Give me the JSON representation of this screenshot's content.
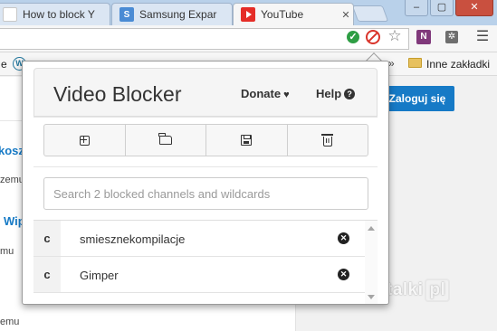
{
  "tabs": [
    {
      "title": "How to block Y",
      "favicon": "google-favicon"
    },
    {
      "title": "Samsung Expar",
      "favicon": "s-favicon",
      "favicon_letter": "S"
    },
    {
      "title": "YouTube",
      "favicon": "youtube-favicon"
    }
  ],
  "toolbar": {
    "icons": [
      "check-icon",
      "block-icon",
      "star-icon",
      "onenote-icon",
      "extension-icon",
      "menu-icon"
    ],
    "onenote_letter": "N"
  },
  "bookmarks": {
    "left_fragment": "e",
    "folder_label": "Inne zakładki"
  },
  "page": {
    "fragments": [
      "koszt",
      "zemu",
      "Wip",
      "mu",
      "emu"
    ],
    "login_button": "Zaloguj się"
  },
  "popup": {
    "title": "Video Blocker",
    "donate_label": "Donate",
    "help_label": "Help",
    "toolbar_buttons": [
      "add-icon",
      "open-folder-icon",
      "save-icon",
      "trash-icon"
    ],
    "search_placeholder": "Search 2 blocked channels and wildcards",
    "blocked_items": [
      {
        "type": "c",
        "name": "smiesznekompilacje"
      },
      {
        "type": "c",
        "name": "Gimper"
      }
    ]
  },
  "watermark": {
    "text": "instalki",
    "suffix": "pl"
  },
  "colors": {
    "accent_blue": "#167ac6",
    "youtube_red": "#e52d27",
    "block_red": "#d9342b",
    "check_green": "#2e9e44"
  }
}
